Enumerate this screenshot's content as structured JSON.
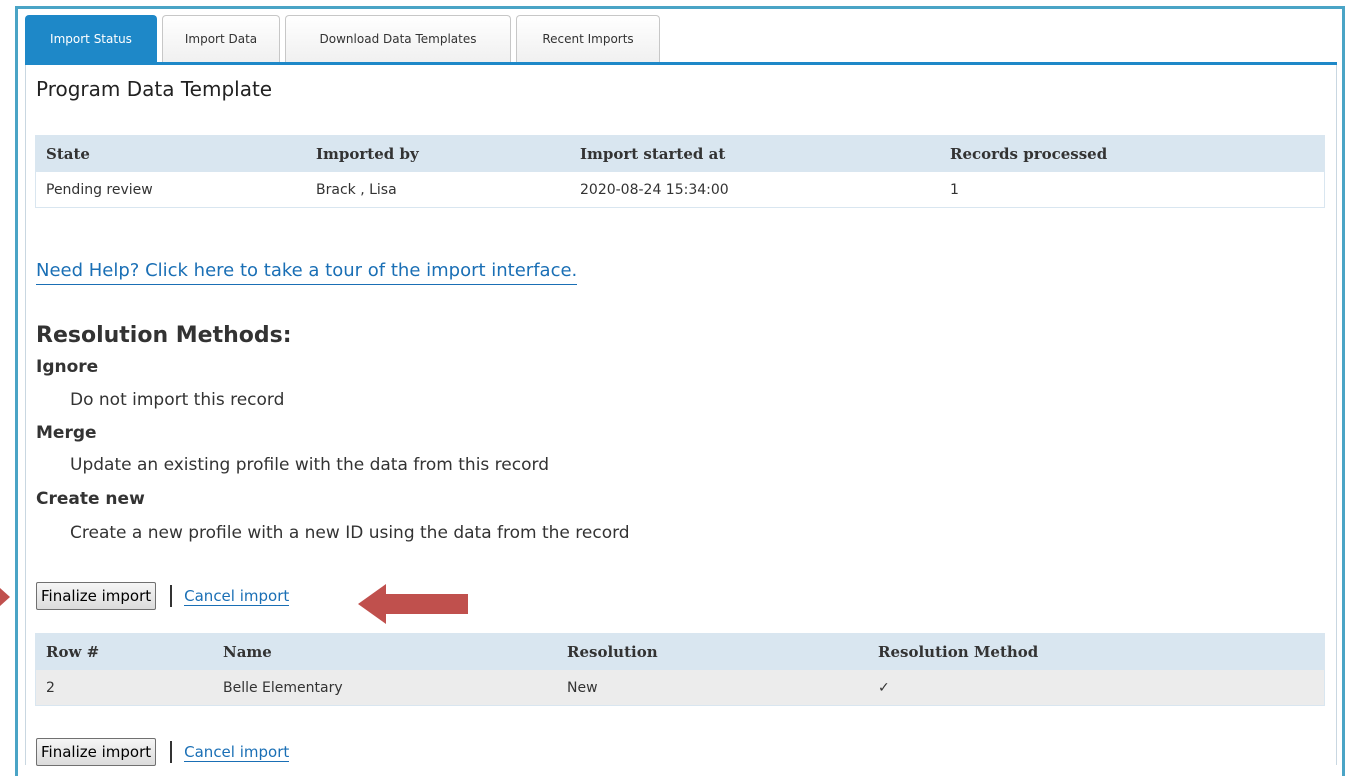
{
  "tabs": [
    {
      "label": "Import Status",
      "active": true
    },
    {
      "label": "Import Data",
      "active": false
    },
    {
      "label": "Download Data Templates",
      "active": false
    },
    {
      "label": "Recent Imports",
      "active": false
    }
  ],
  "page_title": "Program Data Template",
  "status_table": {
    "headers": [
      "State",
      "Imported by",
      "Import started at",
      "Records processed"
    ],
    "row": [
      "Pending review",
      "Brack , Lisa",
      "2020-08-24 15:34:00",
      "1"
    ]
  },
  "help_link": "Need Help? Click here to take a tour of the import interface.",
  "resolution": {
    "heading": "Resolution Methods:",
    "methods": [
      {
        "name": "Ignore",
        "description": "Do not import this record"
      },
      {
        "name": "Merge",
        "description": "Update an existing profile with the data from this record"
      },
      {
        "name": "Create new",
        "description": "Create a new profile with a new ID using the data from the record"
      }
    ]
  },
  "actions": {
    "finalize_label": "Finalize import",
    "cancel_label": "Cancel import"
  },
  "results_table": {
    "headers": [
      "Row #",
      "Name",
      "Resolution",
      "Resolution Method"
    ],
    "rows": [
      [
        "2",
        "Belle Elementary",
        "New",
        "✓"
      ]
    ]
  },
  "colors": {
    "accent": "#1e88c8",
    "frame": "#4aa4c6",
    "callout_arrow": "#c0504d",
    "link": "#1a6fb5",
    "table_header": "#d9e6f0"
  }
}
